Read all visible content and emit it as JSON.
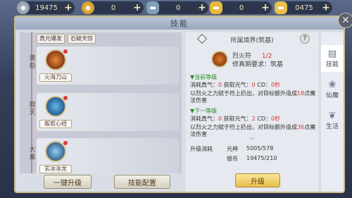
{
  "currencies": [
    {
      "icon": "silver-coin-icon",
      "value": "19475"
    },
    {
      "icon": "gold-coin-icon",
      "value": "0"
    },
    {
      "icon": "blue-ingot-icon",
      "value": "0"
    },
    {
      "icon": "gold-ingot-icon",
      "value": "0"
    },
    {
      "icon": "small-gold-ingot-icon",
      "value": "0475"
    }
  ],
  "window": {
    "title": "技能"
  },
  "skill_list": {
    "top_names": [
      "真元爆发",
      "石破天惊"
    ],
    "rows": [
      {
        "stage": "渡\n劫",
        "name": "火海刀山"
      },
      {
        "stage": "寂\n灭",
        "name": "般若心经"
      },
      {
        "stage": "大\n乘",
        "name": "玄冰冰龙"
      }
    ]
  },
  "buttons": {
    "upgrade_all": "一键升级",
    "skill_config": "技能配置",
    "upgrade": "升级"
  },
  "detail": {
    "realm": "所属境界(筑基)",
    "skill_name": "烈火符",
    "level": "1/2",
    "requirement": "修真期要求：筑基",
    "current_head": "▼当前等级",
    "current_text_a": "消耗真气：",
    "current_cost": "0",
    "current_text_b": " 获取元气：",
    "current_gain": "0",
    "current_text_c": " CD：",
    "current_cd": "0秒",
    "current_desc_a": "以烈火之力赋于符上扔出，对目标额外造成",
    "current_dmg": "18",
    "current_desc_b": "点魔法伤害",
    "next_head": "▼下一等级",
    "next_text_a": "消耗真气：",
    "next_cost": "0",
    "next_text_b": " 获取元气：",
    "next_gain": "2",
    "next_text_c": " CD：",
    "next_cd": "0秒",
    "next_desc_a": "以烈火之力赋于符上扔出，对目标额外造成",
    "next_dmg": "36",
    "next_desc_b": "点魔法伤害",
    "cost_title": "升级消耗",
    "cost_items": [
      {
        "label": "元神",
        "value": "5005/578"
      },
      {
        "label": "银币",
        "value": "19475/210"
      }
    ]
  },
  "tabs": [
    {
      "icon": "book-icon",
      "label": "技能"
    },
    {
      "icon": "lotus-icon",
      "label": "仙魔"
    },
    {
      "icon": "leaf-icon",
      "label": "生活"
    }
  ]
}
